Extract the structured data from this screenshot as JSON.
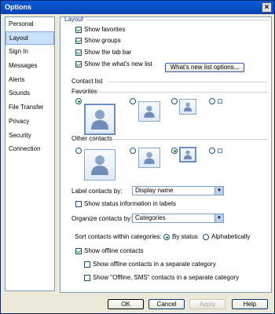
{
  "window": {
    "title": "Options",
    "close_glyph": "×"
  },
  "sidebar": {
    "items": [
      {
        "label": "Personal"
      },
      {
        "label": "Layout"
      },
      {
        "label": "Sign In"
      },
      {
        "label": "Messages"
      },
      {
        "label": "Alerts"
      },
      {
        "label": "Sounds"
      },
      {
        "label": "File Transfer"
      },
      {
        "label": "Privacy"
      },
      {
        "label": "Security"
      },
      {
        "label": "Connection"
      }
    ],
    "selected": "Layout"
  },
  "layout": {
    "section_title": "Layout",
    "show_favorites": {
      "label": "Show favorites",
      "checked": true
    },
    "show_groups": {
      "label": "Show groups",
      "checked": true
    },
    "show_tab_bar": {
      "label": "Show the tab bar",
      "checked": true
    },
    "show_whats_new": {
      "label": "Show the what's new list",
      "checked": true
    },
    "whats_new_button": "What's new list options..."
  },
  "contact_list": {
    "title": "Contact list",
    "favorites_label": "Favorites",
    "favorites_selected": 1,
    "other_label": "Other contacts",
    "other_selected": 3
  },
  "label_contacts": {
    "label": "Label contacts by:",
    "value": "Display name"
  },
  "show_status_info": {
    "label": "Show status information in labels",
    "checked": false
  },
  "organize_contacts": {
    "label": "Organize contacts by:",
    "value": "Categories"
  },
  "sort_within": {
    "label": "Sort contacts within categories:",
    "by_status": "By status",
    "alphabetically": "Alphabetically",
    "selected": "By status"
  },
  "show_offline": {
    "label": "Show offline contacts",
    "checked": true
  },
  "offline_separate": {
    "label": "Show offline contacts in a separate category",
    "checked": false
  },
  "offline_sms_separate": {
    "label": "Show \"Offline, SMS\" contacts in a separate category",
    "checked": false
  },
  "footer": {
    "ok": "OK",
    "cancel": "Cancel",
    "apply": "Apply",
    "help": "Help"
  }
}
